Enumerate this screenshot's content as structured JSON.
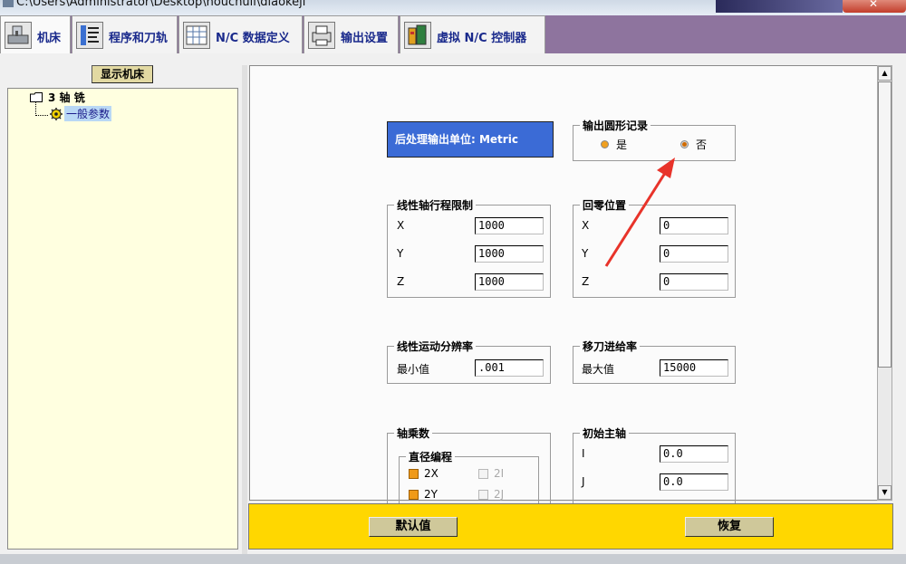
{
  "window": {
    "title": "C:\\Users\\Administrator\\Desktop\\houchuli\\diaokeji"
  },
  "tabs": [
    {
      "label": "机床",
      "icon": "machine-icon",
      "active": true
    },
    {
      "label": "程序和刀轨",
      "icon": "toolpath-icon",
      "active": false
    },
    {
      "label": "N/C 数据定义",
      "icon": "nc-data-icon",
      "active": false
    },
    {
      "label": "输出设置",
      "icon": "printer-icon",
      "active": false
    },
    {
      "label": "虚拟 N/C 控制器",
      "icon": "virtual-controller-icon",
      "active": false
    }
  ],
  "left_panel": {
    "show_button": "显示机床",
    "tree": {
      "root": "3 轴 铣",
      "child": "一般参数"
    }
  },
  "units": {
    "text": "后处理输出单位: Metric"
  },
  "circular_output": {
    "title": "输出圆形记录",
    "options": [
      {
        "label": "是",
        "selected": false
      },
      {
        "label": "否",
        "selected": true
      }
    ]
  },
  "linear_travel_limits": {
    "title": "线性轴行程限制",
    "rows": [
      {
        "label": "X",
        "value": "1000"
      },
      {
        "label": "Y",
        "value": "1000"
      },
      {
        "label": "Z",
        "value": "1000"
      }
    ]
  },
  "home_position": {
    "title": "回零位置",
    "rows": [
      {
        "label": "X",
        "value": "0"
      },
      {
        "label": "Y",
        "value": "0"
      },
      {
        "label": "Z",
        "value": "0"
      }
    ]
  },
  "linear_resolution": {
    "title": "线性运动分辨率",
    "label": "最小值",
    "value": ".001"
  },
  "traverse_feed": {
    "title": "移刀进给率",
    "label": "最大值",
    "value": "15000"
  },
  "axis_multiplier": {
    "title": "轴乘数",
    "diameter_title": "直径编程",
    "checks": [
      {
        "label": "2X",
        "checked": true,
        "enabled": true
      },
      {
        "label": "2I",
        "checked": false,
        "enabled": false
      },
      {
        "label": "2Y",
        "checked": true,
        "enabled": true
      },
      {
        "label": "2J",
        "checked": false,
        "enabled": false
      }
    ]
  },
  "initial_spindle": {
    "title": "初始主轴",
    "rows": [
      {
        "label": "I",
        "value": "0.0"
      },
      {
        "label": "J",
        "value": "0.0"
      }
    ]
  },
  "bottom": {
    "default_label": "默认值",
    "restore_label": "恢复"
  },
  "colors": {
    "tab_bar": "#8e749e",
    "units_box": "#3b6bd6",
    "bottom_bar": "#ffd700",
    "tree_bg": "#ffffe0",
    "annotation_arrow": "#e8332a"
  }
}
